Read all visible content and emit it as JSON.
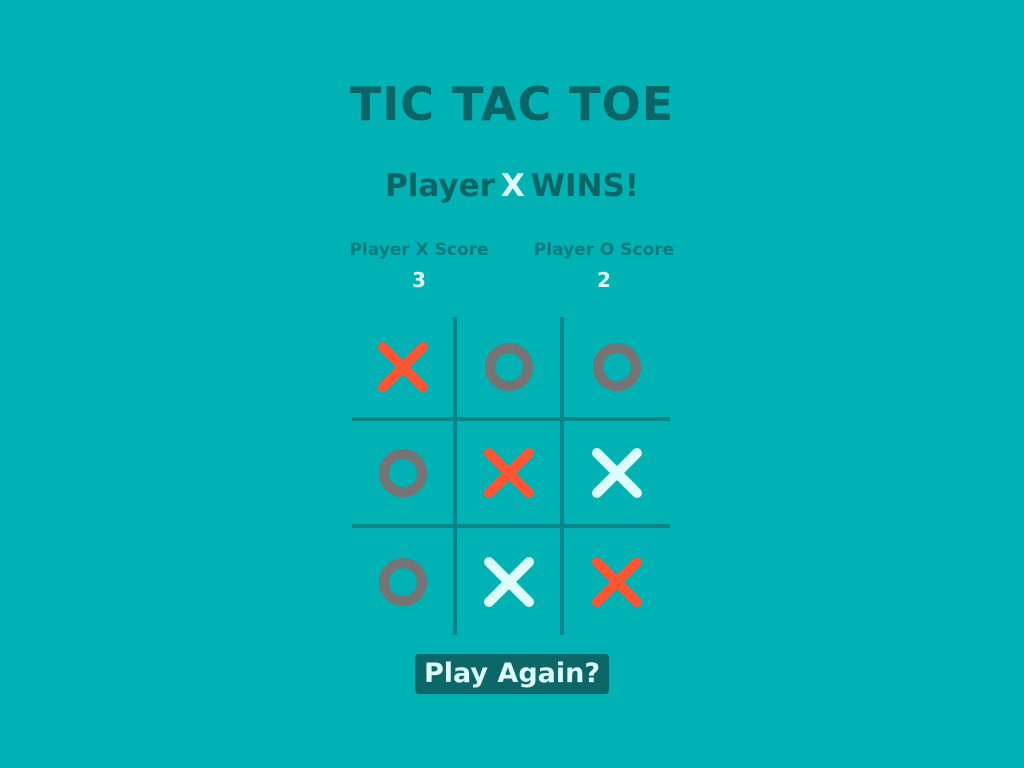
{
  "game": {
    "title": "TIC TAC TOE",
    "status_prefix": "Player",
    "status_mark": "X",
    "status_suffix": "WINS!"
  },
  "scores": {
    "x": {
      "label": "Player X Score",
      "value": "3"
    },
    "o": {
      "label": "Player O Score",
      "value": "2"
    }
  },
  "board": {
    "cells": [
      "X",
      "O",
      "O",
      "O",
      "X",
      "X",
      "O",
      "X",
      "X"
    ],
    "winning_line": [
      0,
      4,
      8
    ]
  },
  "actions": {
    "play_again_label": "Play Again?"
  },
  "colors": {
    "background": "#00b2b3",
    "text_dark": "#0b6466",
    "text_light": "#ddfbfb",
    "x_winning": "#ff5533",
    "x_normal": "#ddfbfb",
    "o_mark": "#757373",
    "grid_line": "#0d8586",
    "button_bg": "#0d6668"
  }
}
